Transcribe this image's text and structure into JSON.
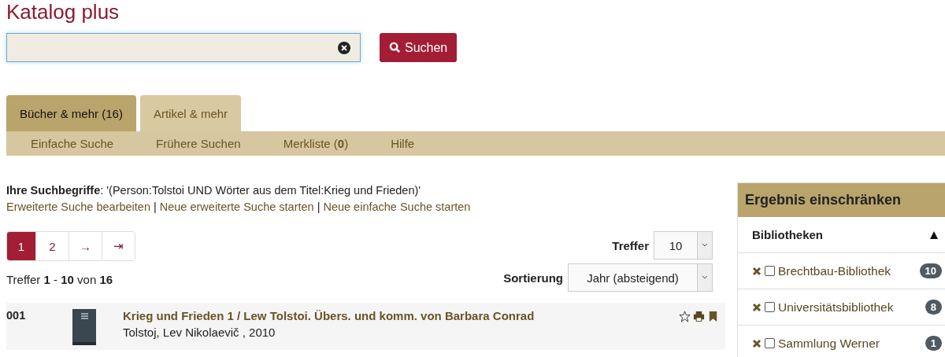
{
  "title": "Katalog plus",
  "search": {
    "button": "Suchen"
  },
  "tabs": [
    {
      "label": "Bücher & mehr (16)",
      "selected": true
    },
    {
      "label": "Artikel & mehr",
      "selected": false
    }
  ],
  "subnav": [
    "Einfache Suche",
    "Frühere Suchen",
    "Merkliste (**0**)",
    "Hilfe"
  ],
  "query": "**Ihre Suchbegriffe**: '(Person:Tolstoi UND Wörter aus dem Titel:Krieg und Frieden)'",
  "query_links": [
    "Erweiterte Suche bearbeiten",
    "Neue erweiterte Suche starten",
    "Neue einfache Suche starten"
  ],
  "link_separator": "|",
  "pagination": [
    {
      "label": "1",
      "selected": true
    },
    {
      "label": "2",
      "selected": false
    },
    {
      "label": "→",
      "selected": false
    },
    {
      "label": "⇥",
      "selected": false
    }
  ],
  "hits_label": "Treffer",
  "hits_value": "10",
  "sort_label": "Sortierung",
  "sort_value": "Jahr (absteigend)",
  "hits_summary": "Treffer **1** - **10** von **16**",
  "results": [
    {
      "number": "001",
      "title": "Krieg und Frieden 1 / Lew Tolstoi. Übers. und komm. von Barbara Conrad",
      "meta": "Tolstoj, Lev Nikolaevič , 2010"
    }
  ],
  "sidebar": {
    "title": "Ergebnis einschränken",
    "section": "Bibliotheken",
    "expanded": true,
    "items": [
      {
        "label": "Brechtbau-Bibliothek",
        "count": "10",
        "checked": false
      },
      {
        "label": "Universitätsbibliothek",
        "count": "8",
        "checked": false
      },
      {
        "label": "Sammlung Werner",
        "count": "1",
        "checked": false
      }
    ]
  }
}
